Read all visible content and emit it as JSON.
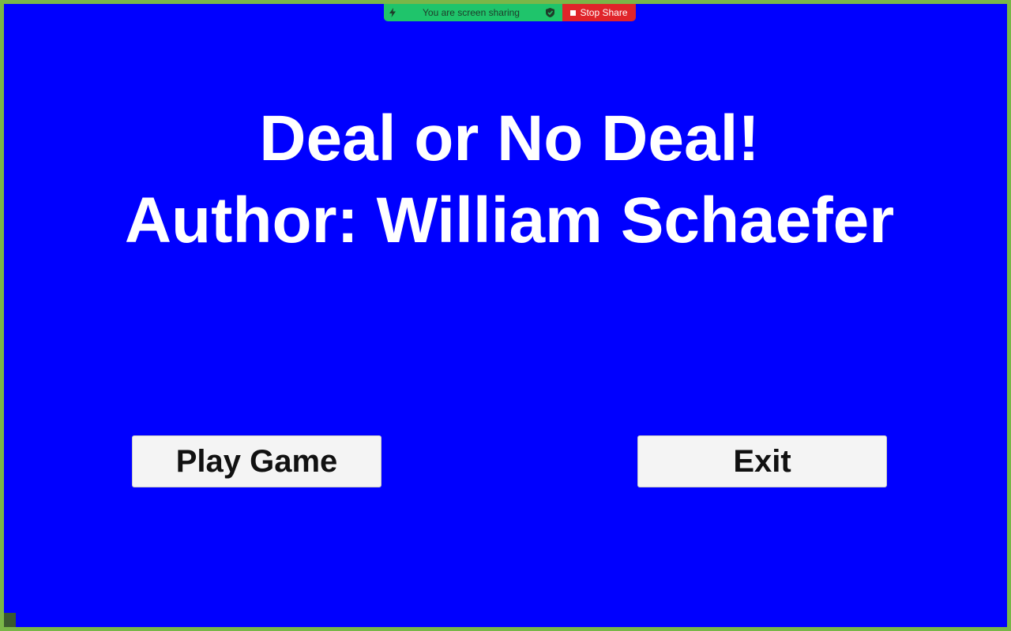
{
  "share_bar": {
    "status_text": "You are screen sharing",
    "stop_label": "Stop Share",
    "status_color": "#1fc46b",
    "stop_color": "#e0242a",
    "left_icon": "lightning-icon",
    "right_icon": "shield-check-icon"
  },
  "title": {
    "line1": "Deal or No Deal!",
    "line2": "Author: William Schaefer"
  },
  "buttons": {
    "play_label": "Play Game",
    "exit_label": "Exit"
  },
  "colors": {
    "background": "#0000ff",
    "frame_border": "#7ab648",
    "title_text": "#ffffff",
    "button_bg": "#f4f4f4"
  }
}
